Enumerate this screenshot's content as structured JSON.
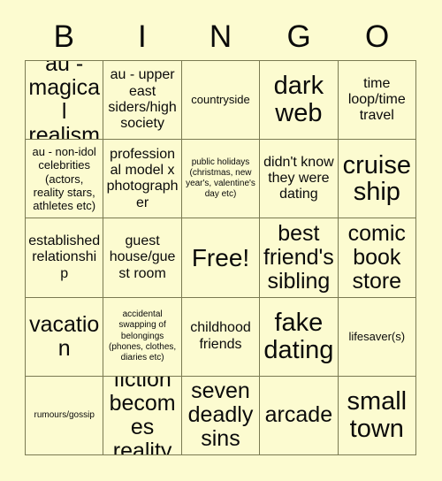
{
  "header": {
    "letters": [
      "B",
      "I",
      "N",
      "G",
      "O"
    ]
  },
  "grid": {
    "rows": 5,
    "columns": 5,
    "background_color": "#fcfbd0",
    "border_color": "#7a7a52",
    "text_color": "#0a0a0a",
    "cells": [
      {
        "text": "au - magical realism",
        "size": "lg"
      },
      {
        "text": "au - upper east siders/high society",
        "size": "md"
      },
      {
        "text": "countryside",
        "size": "sm"
      },
      {
        "text": "dark web",
        "size": "xl"
      },
      {
        "text": "time loop/time travel",
        "size": "md"
      },
      {
        "text": "au - non-idol celebrities (actors, reality stars, athletes etc)",
        "size": "sm"
      },
      {
        "text": "professional model x photographer",
        "size": "md"
      },
      {
        "text": "public holidays (christmas, new year's, valentine's day etc)",
        "size": "xs"
      },
      {
        "text": "didn't know they were dating",
        "size": "md"
      },
      {
        "text": "cruise ship",
        "size": "xl"
      },
      {
        "text": "established relationship",
        "size": "md"
      },
      {
        "text": "guest house/guest room",
        "size": "md"
      },
      {
        "text": "Free!",
        "size": "free"
      },
      {
        "text": "best friend's sibling",
        "size": "lg"
      },
      {
        "text": "comic book store",
        "size": "lg"
      },
      {
        "text": "vacation",
        "size": "lg"
      },
      {
        "text": "accidental swapping of belongings (phones, clothes, diaries etc)",
        "size": "xs"
      },
      {
        "text": "childhood friends",
        "size": "md"
      },
      {
        "text": "fake dating",
        "size": "xl"
      },
      {
        "text": "lifesaver(s)",
        "size": "sm"
      },
      {
        "text": "rumours/gossip",
        "size": "xs"
      },
      {
        "text": "fiction becomes reality",
        "size": "lg"
      },
      {
        "text": "seven deadly sins",
        "size": "lg"
      },
      {
        "text": "arcade",
        "size": "lg"
      },
      {
        "text": "small town",
        "size": "xl"
      }
    ]
  }
}
